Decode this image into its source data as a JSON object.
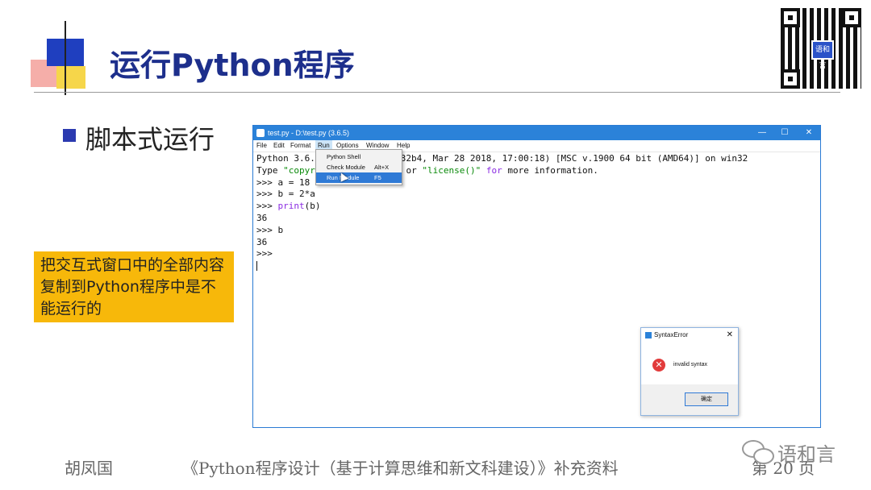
{
  "slide": {
    "title": "运行Python程序",
    "bullet": "脚本式运行",
    "note": "把交互式窗口中的全部内容复制到Python程序中是不能运行的",
    "qr_logo": "语和言"
  },
  "window": {
    "title": "test.py - D:\\test.py (3.6.5)",
    "minimize": "—",
    "maximize": "☐",
    "close": "✕",
    "menu": [
      "File",
      "Edit",
      "Format",
      "Run",
      "Options",
      "Window",
      "Help"
    ],
    "active_menu": "Run"
  },
  "editor": {
    "lines": [
      "Python 3.6.5 (v3.6.5:f59c0932b4, Mar 28 2018, 17:00:18) [MSC v.1900 64 bit (AMD64)] on win32",
      "Type \"copyright\", \"credits\" or \"license()\" for more information.",
      ">>> a = 18",
      ">>> b = 2*a",
      ">>> print(b)",
      "36",
      ">>> b",
      "36",
      ">>>"
    ]
  },
  "run_menu": {
    "items": [
      {
        "label": "Python Shell",
        "shortcut": ""
      },
      {
        "label": "Check Module",
        "shortcut": "Alt+X"
      },
      {
        "label": "Run Module",
        "shortcut": "F5"
      }
    ],
    "selected": "Run Module"
  },
  "error_dialog": {
    "title": "SyntaxError",
    "close": "✕",
    "icon": "✕",
    "message": "invalid syntax",
    "ok": "确定"
  },
  "footer": {
    "author": "胡凤国",
    "book": "《Python程序设计（基于计算思维和新文科建设）》补充资料",
    "page": "第 20 页",
    "wechat": "语和言"
  },
  "colors": {
    "title": "#1d2f8c",
    "note_bg": "#f7b80a",
    "titlebar": "#2b82d9",
    "menu_selected": "#2f7ad6",
    "error": "#e23c3c"
  }
}
